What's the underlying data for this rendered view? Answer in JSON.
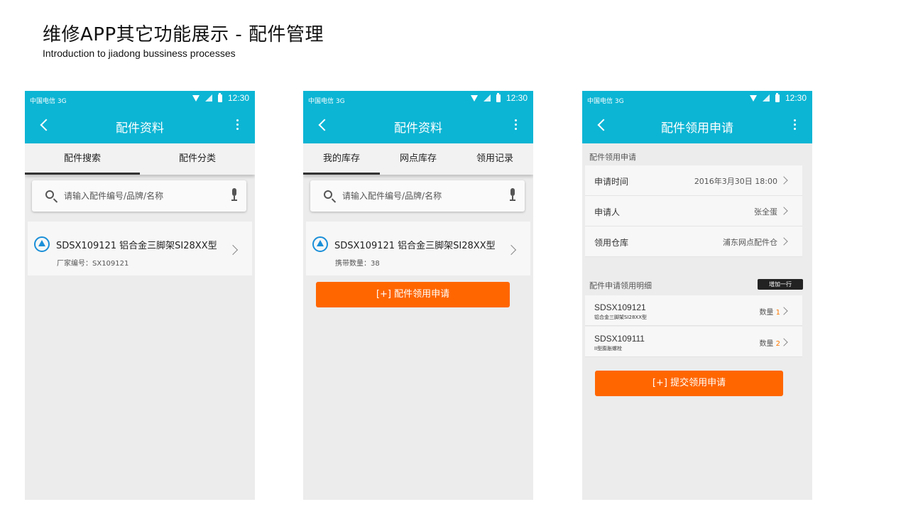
{
  "header": {
    "title": "维修APP其它功能展示 -  配件管理",
    "subtitle": "Introduction to jiadong bussiness processes"
  },
  "statusbar": {
    "carrier": "中国电信 3G",
    "time": "12:30"
  },
  "colors": {
    "primary": "#0cb5d4",
    "accent": "#ff6600",
    "qty_highlight": "#ff7800"
  },
  "icons": [
    "back-chevron-icon",
    "more-vert-icon",
    "search-icon",
    "mic-icon",
    "part-logo-icon",
    "chevron-right-icon",
    "wifi-icon",
    "signal-icon",
    "battery-icon"
  ],
  "screen1": {
    "title": "配件资料",
    "tabs": [
      "配件搜索",
      "配件分类"
    ],
    "search_placeholder": "请输入配件编号/品牌/名称",
    "part": {
      "name": "SDSX109121 铝合金三脚架SI28XX型",
      "sub": "厂家编号：SX109121"
    }
  },
  "screen2": {
    "title": "配件资料",
    "tabs": [
      "我的库存",
      "网点库存",
      "领用记录"
    ],
    "search_placeholder": "请输入配件编号/品牌/名称",
    "part": {
      "name": "SDSX109121 铝合金三脚架SI28XX型",
      "sub": "携带数量：38"
    },
    "apply_button": "[+] 配件领用申请"
  },
  "screen3": {
    "title": "配件领用申请",
    "section1": "配件领用申请",
    "fields": [
      {
        "label": "申请时间",
        "value": "2016年3月30日 18:00"
      },
      {
        "label": "申请人",
        "value": "张全蛋"
      },
      {
        "label": "领用仓库",
        "value": "浦东网点配件仓"
      }
    ],
    "section2": "配件申请领用明细",
    "add_row": "增加一行",
    "items": [
      {
        "code": "SDSX109121",
        "desc": "铝合金三脚架SI28XX型",
        "qty_label": "数量",
        "qty": "1"
      },
      {
        "code": "SDSX109111",
        "desc": "II型膨胀螺栓",
        "qty_label": "数量",
        "qty": "2"
      }
    ],
    "submit_button": "[+] 提交领用申请"
  }
}
